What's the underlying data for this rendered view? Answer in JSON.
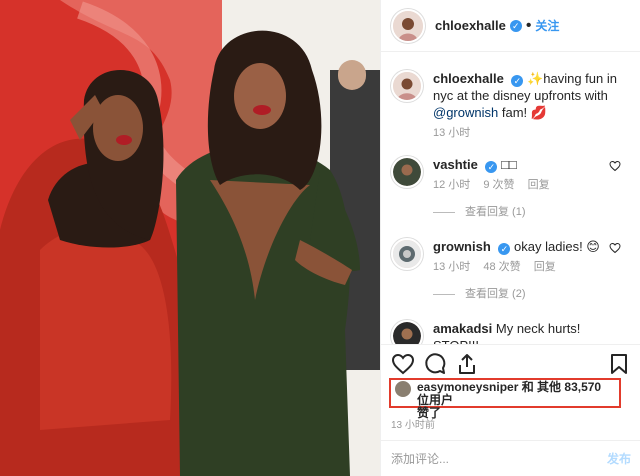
{
  "post": {
    "username": "chloexhalle",
    "follow_label": "关注",
    "caption_user": "chloexhalle",
    "caption_text_1": "✨having fun in nyc at the disney upfronts with",
    "caption_mention": "@grownish",
    "caption_text_2": "fam! 💋",
    "caption_time": "13 小时",
    "comments": [
      {
        "user": "vashtie",
        "text": "□□",
        "time": "12 小时",
        "likes": "9 次赞",
        "reply": "回复",
        "view_replies": "查看回复 (1)"
      },
      {
        "user": "grownish",
        "text": "okay ladies! 😊",
        "time": "13 小时",
        "likes": "48 次赞",
        "reply": "回复",
        "view_replies": "查看回复 (2)"
      },
      {
        "user": "amakadsi",
        "text": "My neck hurts! STOP!!!"
      }
    ],
    "likes_user": "easymoneysniper",
    "likes_text": " 和 其他 83,570 位用户",
    "likes_text_2": "赞了",
    "post_time": "13 小时前",
    "comment_placeholder": "添加评论...",
    "post_button": "发布"
  },
  "colors": {
    "accent": "#3897f0",
    "highlight_box": "#e23b2c",
    "muted": "#999999"
  },
  "icons": [
    "verified-icon",
    "heart-icon",
    "comment-icon",
    "share-icon",
    "bookmark-icon"
  ]
}
